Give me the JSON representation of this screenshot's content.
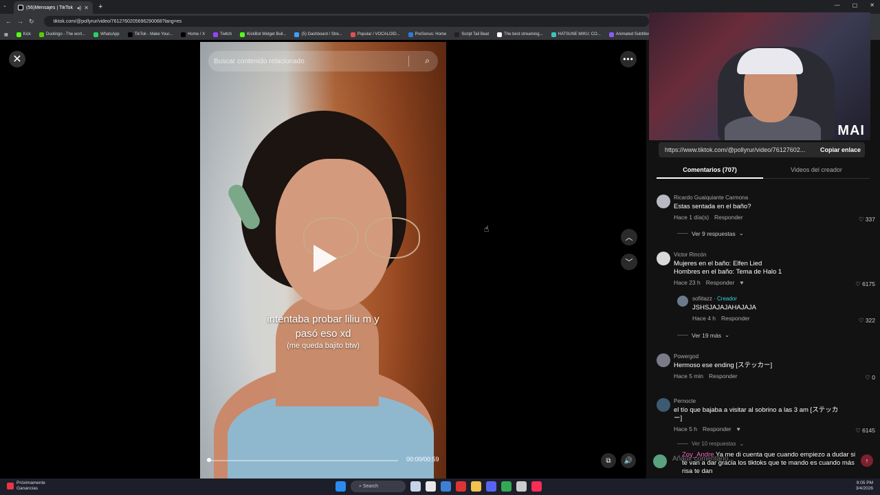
{
  "browser": {
    "tab_title": "(56)Mensajes | TikTok",
    "url": "tiktok.com/@pollyrur/video/7612760205696290068?lang=es",
    "bookmarks": [
      {
        "label": "Kick",
        "color": "#53fc18"
      },
      {
        "label": "Duolingo - The worl...",
        "color": "#58cc02"
      },
      {
        "label": "WhatsApp",
        "color": "#25d366"
      },
      {
        "label": "TikTok - Make Your...",
        "color": "#000000"
      },
      {
        "label": "Home / X",
        "color": "#000000"
      },
      {
        "label": "Twitch",
        "color": "#9146ff"
      },
      {
        "label": "KickBot Widget Buil...",
        "color": "#53fc18"
      },
      {
        "label": "(5) Dashboard / Stre...",
        "color": "#3aa0ff"
      },
      {
        "label": "Popular / VOCALOID...",
        "color": "#e05050"
      },
      {
        "label": "PreSonus: Home",
        "color": "#2b7bd6"
      },
      {
        "label": "Script Tail Beat",
        "color": "#222222"
      },
      {
        "label": "The best streaming...",
        "color": "#ffffff"
      },
      {
        "label": "HATSUNE MIKU: CO...",
        "color": "#39c5bb"
      },
      {
        "label": "Animated Subtitles...",
        "color": "#8a5cf6"
      },
      {
        "label": "HA",
        "color": "#ffffff"
      }
    ]
  },
  "video": {
    "search_placeholder": "Buscar contenido relacionado",
    "caption_line1": "intentaba probar liliu m y",
    "caption_line2": "pasó eso xd",
    "caption_line3": "(me queda bajito btw)",
    "timecode": "00:00/00:59",
    "progress": 0.0
  },
  "webcam": {
    "logo": "MAI"
  },
  "panel": {
    "link_url": "https://www.tiktok.com/@pollyrur/video/76127602...",
    "copy_label": "Copiar enlace",
    "tab_comments": "Comentarios (707)",
    "tab_creator": "Videos del creador",
    "reply_label": "Responder",
    "comments": [
      {
        "user": "Ricardo Guaiquiante Carmona",
        "text": "Estas sentada en el baño?",
        "time": "Hace 1 día(s)",
        "likes": "337",
        "replies": "Ver 9 respuestas"
      },
      {
        "user": "Victor Rincón",
        "text1": "Mujeres en el baño: Elfen Lied",
        "text2": "Hombres en el baño: Tema de Halo 1",
        "time": "Hace 23 h",
        "likes": "6175"
      },
      {
        "user": "sofiitazz",
        "creator_tag": "· Creador",
        "text": "JSHSJAJAJAHAJAJA",
        "time": "Hace 4 h",
        "likes": "322",
        "replies": "Ver 19 más"
      },
      {
        "user": "Powergod",
        "text": "Hermoso ese ending [ステッカー]",
        "time": "Hace 5 min",
        "likes": "0"
      },
      {
        "user": "Pernocte",
        "text1": "el tío que bajaba a visitar al sobrino a las 3 am [ステッカ",
        "text2": "ー]",
        "time": "Hace 5 h",
        "likes": "6145",
        "replies": "Ver 10 respuestas"
      }
    ],
    "comment_placeholder": "Añadir comentario..."
  },
  "chat": {
    "user": "Zoy_Andre",
    "message": "Ya me di cuenta que cuando empiezo a dudar si te van a dar gracia los tiktoks que te mando es cuando más risa te dan"
  },
  "taskbar": {
    "left_line1": "Próximamente",
    "left_line2": "Ganancias",
    "search": "Search",
    "time": "9:05 PM",
    "date": "3/4/2026"
  }
}
